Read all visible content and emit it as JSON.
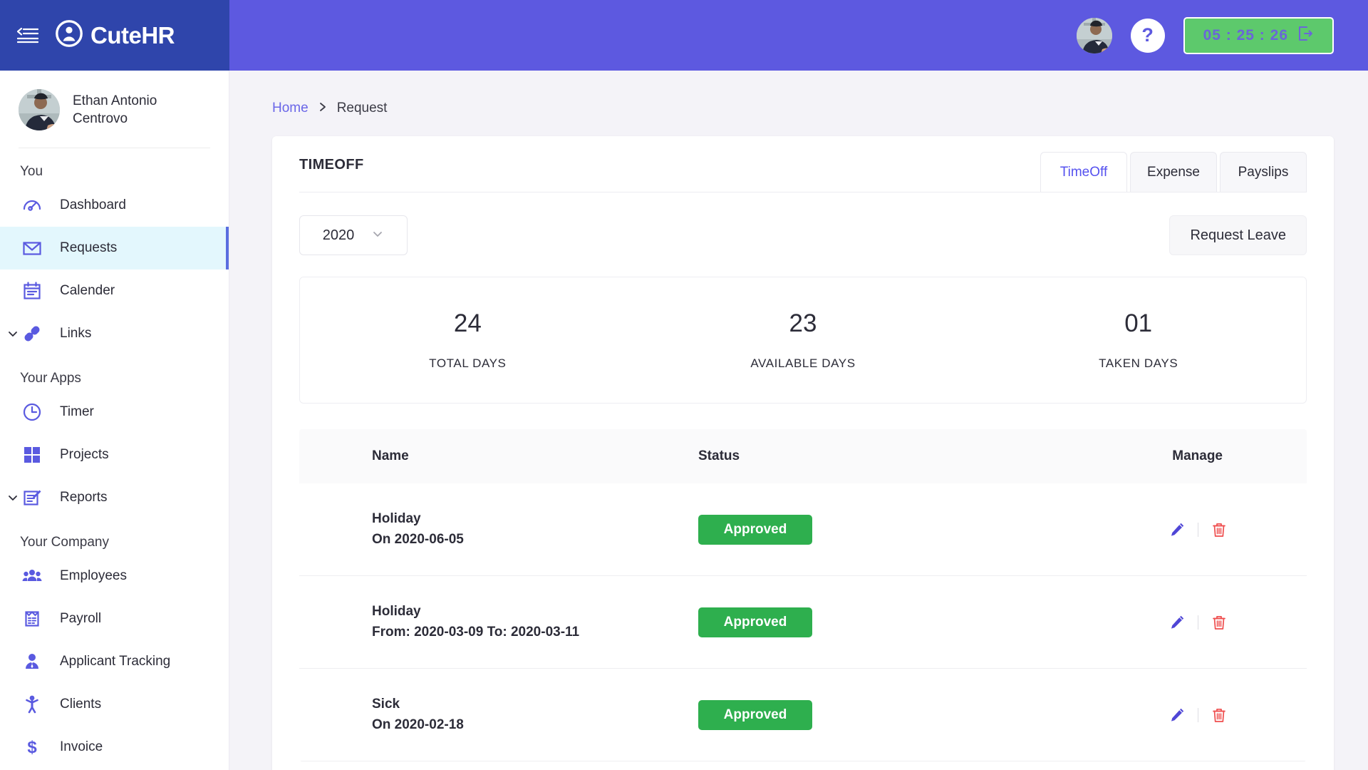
{
  "brand": {
    "name": "CuteHR",
    "logo_icon": "user-circle-icon",
    "collapse_icon": "collapse-sidebar-icon"
  },
  "topbar": {
    "help_label": "?",
    "timer_value": "05 : 25 : 26",
    "timer_icon": "logout-icon",
    "avatar_alt": "user-avatar",
    "colors": {
      "brand_bg": "#2f45ab",
      "bar_bg": "#5d59e0",
      "timer_bg": "#5dc96c",
      "timer_text": "#6a66d8"
    }
  },
  "sidebar": {
    "user": {
      "name": "Ethan Antonio Centrovo",
      "avatar_alt": "user-avatar"
    },
    "sections": [
      {
        "title": "You",
        "items": [
          {
            "label": "Dashboard",
            "icon": "speedometer-icon",
            "active": false,
            "expandable": false
          },
          {
            "label": "Requests",
            "icon": "envelope-icon",
            "active": true,
            "expandable": false
          },
          {
            "label": "Calender",
            "icon": "calendar-icon",
            "active": false,
            "expandable": false
          },
          {
            "label": "Links",
            "icon": "link-icon",
            "active": false,
            "expandable": true
          }
        ]
      },
      {
        "title": "Your Apps",
        "items": [
          {
            "label": "Timer",
            "icon": "clock-icon",
            "active": false,
            "expandable": false
          },
          {
            "label": "Projects",
            "icon": "grid-icon",
            "active": false,
            "expandable": false
          },
          {
            "label": "Reports",
            "icon": "document-edit-icon",
            "active": false,
            "expandable": true
          }
        ]
      },
      {
        "title": "Your Company",
        "items": [
          {
            "label": "Employees",
            "icon": "people-icon",
            "active": false,
            "expandable": false
          },
          {
            "label": "Payroll",
            "icon": "clipboard-icon",
            "active": false,
            "expandable": false
          },
          {
            "label": "Applicant Tracking",
            "icon": "person-tie-icon",
            "active": false,
            "expandable": false
          },
          {
            "label": "Clients",
            "icon": "person-arms-up-icon",
            "active": false,
            "expandable": false
          },
          {
            "label": "Invoice",
            "icon": "dollar-icon",
            "active": false,
            "expandable": false
          }
        ]
      }
    ],
    "active_color": "#e3f7fd",
    "accent_color": "#5a6ee0"
  },
  "breadcrumb": {
    "home": "Home",
    "separator": "›",
    "current": "Request"
  },
  "main": {
    "card_title": "TIMEOFF",
    "tabs": [
      {
        "label": "TimeOff",
        "active": true
      },
      {
        "label": "Expense",
        "active": false
      },
      {
        "label": "Payslips",
        "active": false
      }
    ],
    "year_select": {
      "value": "2020",
      "icon": "chevron-down-icon"
    },
    "request_leave_label": "Request Leave",
    "stats": [
      {
        "value": "24",
        "label": "TOTAL DAYS"
      },
      {
        "value": "23",
        "label": "AVAILABLE DAYS"
      },
      {
        "value": "01",
        "label": "TAKEN DAYS"
      }
    ],
    "table": {
      "headers": {
        "name": "Name",
        "status": "Status",
        "manage": "Manage"
      },
      "rows": [
        {
          "title": "Holiday",
          "sub": "On 2020-06-05",
          "status": "Approved",
          "status_color": "#2eaf4e"
        },
        {
          "title": "Holiday",
          "sub": "From: 2020-03-09 To: 2020-03-11",
          "status": "Approved",
          "status_color": "#2eaf4e"
        },
        {
          "title": "Sick",
          "sub": "On 2020-02-18",
          "status": "Approved",
          "status_color": "#2eaf4e"
        }
      ],
      "row_actions": {
        "edit_icon": "pencil-icon",
        "delete_icon": "trash-icon"
      }
    }
  }
}
